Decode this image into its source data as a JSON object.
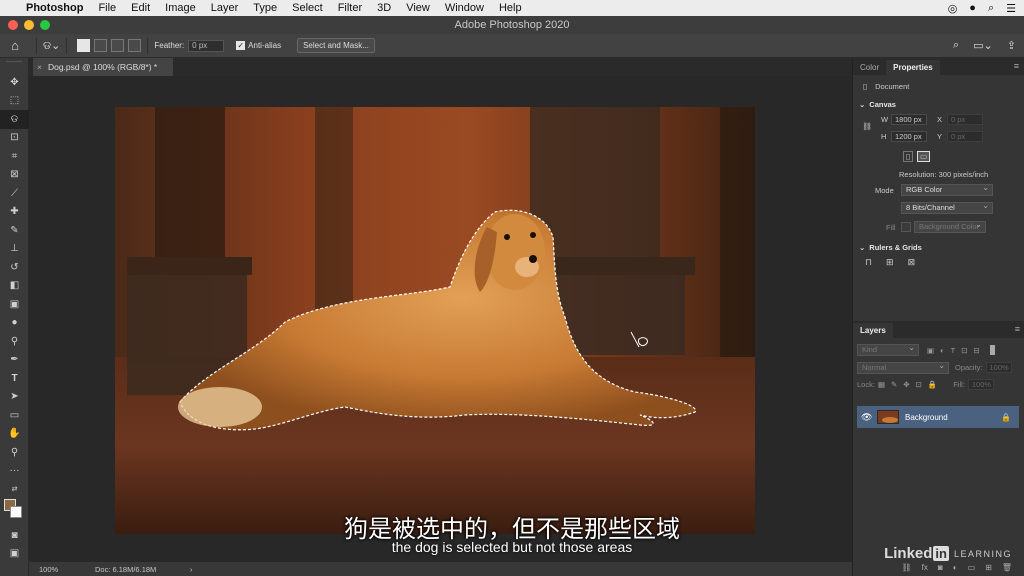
{
  "menubar": {
    "app": "Photoshop",
    "menus": [
      "File",
      "Edit",
      "Image",
      "Layer",
      "Type",
      "Select",
      "Filter",
      "3D",
      "View",
      "Window",
      "Help"
    ]
  },
  "window": {
    "title": "Adobe Photoshop 2020"
  },
  "options": {
    "feather_label": "Feather:",
    "feather_value": "0 px",
    "antialias_label": "Anti-alias",
    "select_mask_label": "Select and Mask..."
  },
  "document": {
    "tab_title": "Dog.psd @ 100% (RGB/8*) *",
    "close": "×"
  },
  "status": {
    "zoom": "100%",
    "doc": "Doc: 6.18M/6.18M",
    "arrow": "›"
  },
  "subtitles": {
    "chinese": "狗是被选中的，但不是那些区域",
    "english": "the dog is selected but not those areas"
  },
  "panels": {
    "tabs": [
      "Color",
      "Properties"
    ],
    "active_tab": "Properties",
    "document_label": "Document",
    "canvas": {
      "section": "Canvas",
      "w_label": "W",
      "w_value": "1800 px",
      "h_label": "H",
      "h_value": "1200 px",
      "x_label": "X",
      "x_value": "0 px",
      "y_label": "Y",
      "y_value": "0 px",
      "resolution": "Resolution: 300 pixels/inch",
      "mode_label": "Mode",
      "mode_value": "RGB Color",
      "bits_value": "8 Bits/Channel",
      "fill_label": "Fill",
      "fill_value": "Background Color"
    },
    "rulers_section": "Rulers & Grids"
  },
  "layers": {
    "tab": "Layers",
    "kind_placeholder": "Kind",
    "blend_mode": "Normal",
    "opacity_label": "Opacity:",
    "opacity_value": "100%",
    "lock_label": "Lock:",
    "fill_label": "Fill:",
    "fill_value": "100%",
    "items": [
      {
        "name": "Background",
        "visible": true,
        "locked": true
      }
    ]
  },
  "branding": {
    "linked": "Linked",
    "in": "in",
    "learning": "LEARNING"
  },
  "colors": {
    "accent_layer": "#4a6280",
    "close": "#ff5f57",
    "minimize": "#febc2e",
    "maximize": "#28c840",
    "foreground_swatch": "#8a6a45"
  }
}
